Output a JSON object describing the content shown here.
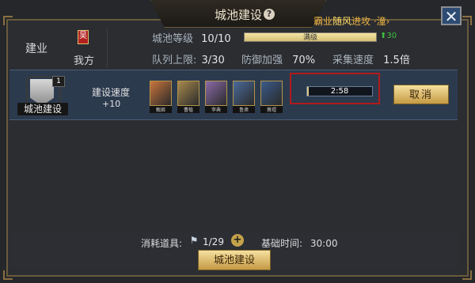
{
  "window": {
    "title": "城池建设"
  },
  "marquee": {
    "prefix": "霸业",
    "highlight": "随风",
    "suffix": "进攻 ·潼›"
  },
  "city": {
    "name": "建业",
    "faction_badge": "吴",
    "faction_label": "我方"
  },
  "stats": {
    "level_label": "城池等级",
    "level_value": "10/10",
    "level_bar_text": "满级",
    "level_progress": 1.0,
    "level_gain": "30",
    "queue_label": "队列上限:",
    "queue_value": "3/30",
    "defense_label": "防御加强",
    "defense_value": "70%",
    "gather_label": "采集速度",
    "gather_value": "1.5倍"
  },
  "building": {
    "level": "1",
    "label": "城池建设",
    "speed_label": "建设速度",
    "speed_value": "+10"
  },
  "heroes": [
    {
      "name": "甄姬",
      "color": "#c8743c"
    },
    {
      "name": "曹植",
      "color": "#a88a4e"
    },
    {
      "name": "李典",
      "color": "#8a6aa8"
    },
    {
      "name": "鲁肃",
      "color": "#4a6a9a"
    },
    {
      "name": "蔡瑁",
      "color": "#3a5a8a"
    }
  ],
  "timer": {
    "text": "2:58",
    "progress": 0.02
  },
  "buttons": {
    "cancel": "取消",
    "build": "城池建设"
  },
  "footer": {
    "consume_label": "消耗道具:",
    "item_count": "1/29",
    "base_time_label": "基础时间:",
    "base_time_value": "30:00"
  },
  "colors": {
    "accent_gold": "#c59a44",
    "timer_highlight": "#b01b1b",
    "level_up": "#3ec23e"
  }
}
